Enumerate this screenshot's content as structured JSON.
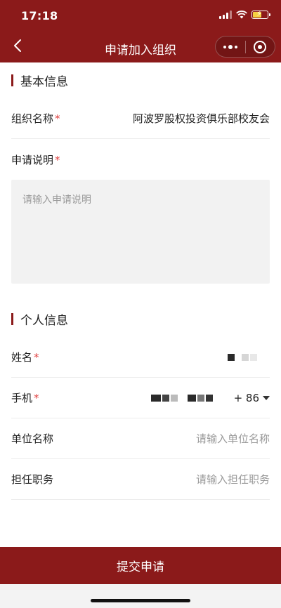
{
  "status": {
    "time": "17:18"
  },
  "nav": {
    "title": "申请加入组织"
  },
  "basic": {
    "title": "基本信息",
    "org_label": "组织名称",
    "org_value": "阿波罗股权投资俱乐部校友会",
    "desc_label": "申请说明",
    "desc_placeholder": "请输入申请说明"
  },
  "personal": {
    "title": "个人信息",
    "name_label": "姓名",
    "phone_label": "手机",
    "country_code": "+ 86",
    "unit_label": "单位名称",
    "unit_placeholder": "请输入单位名称",
    "position_label": "担任职务",
    "position_placeholder": "请输入担任职务"
  },
  "required_mark": "*",
  "submit": {
    "label": "提交申请"
  },
  "colors": {
    "brand": "#8b1a1a",
    "required": "#e04040",
    "placeholder": "#999999",
    "input_bg": "#f2f2f2"
  },
  "icons": {
    "back": "chevron-left-icon",
    "more": "more-dots-icon",
    "close": "mini-program-close-icon",
    "dropdown": "caret-down-icon"
  }
}
